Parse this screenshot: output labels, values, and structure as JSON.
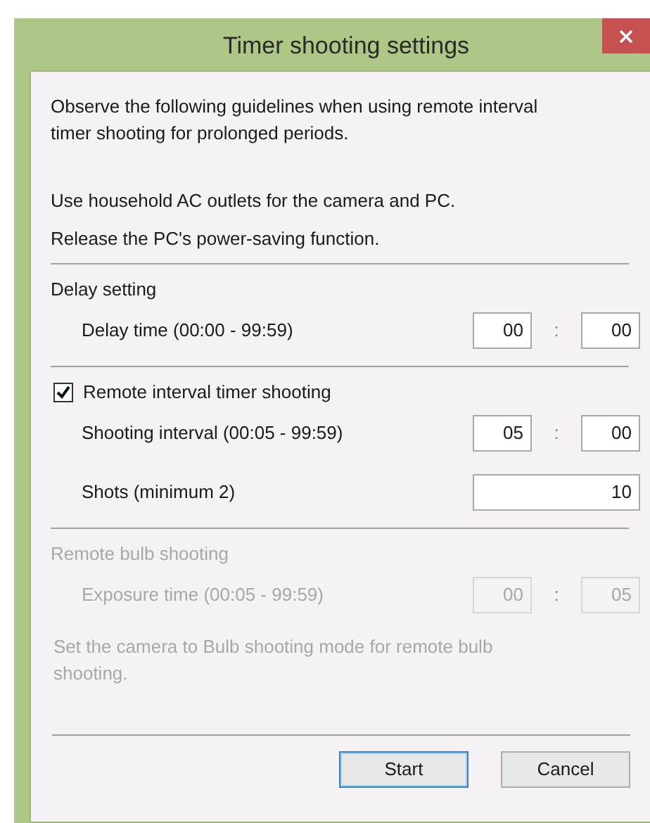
{
  "window": {
    "title": "Timer shooting settings"
  },
  "guidelines": {
    "intro": "Observe the following guidelines when using remote interval timer shooting for prolonged periods.",
    "items": [
      "Use household AC outlets for the camera and PC.",
      "Release the PC's power-saving function."
    ]
  },
  "sections": [
    {
      "kind": "header",
      "title": "Delay setting",
      "disabled": false,
      "rows": [
        {
          "kind": "time",
          "label": "Delay time (00:00 - 99:59)",
          "minutes": "00",
          "separator": ":",
          "seconds": "00"
        }
      ]
    },
    {
      "kind": "checkbox",
      "title": "Remote interval timer shooting",
      "checked": true,
      "disabled": false,
      "rows": [
        {
          "kind": "time",
          "label": "Shooting interval (00:05 - 99:59)",
          "minutes": "05",
          "separator": ":",
          "seconds": "00"
        },
        {
          "kind": "number",
          "label": "Shots (minimum 2)",
          "value": "10"
        }
      ]
    },
    {
      "kind": "header",
      "title": "Remote bulb shooting",
      "disabled": true,
      "rows": [
        {
          "kind": "time",
          "label": "Exposure time (00:05 - 99:59)",
          "minutes": "00",
          "separator": ":",
          "seconds": "05"
        }
      ],
      "note": "Set the camera to Bulb shooting mode for remote bulb shooting."
    }
  ],
  "buttons": [
    {
      "label": "Start",
      "default": true
    },
    {
      "label": "Cancel",
      "default": false
    }
  ]
}
